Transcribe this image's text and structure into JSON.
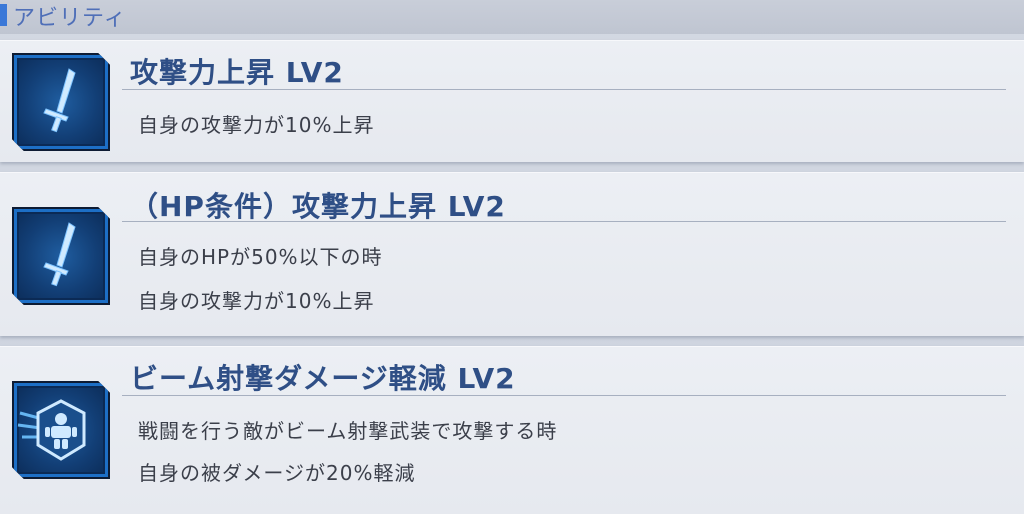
{
  "section": {
    "label": "アビリティ"
  },
  "abilities": [
    {
      "title": "攻撃力上昇 LV2",
      "icon": "sword-icon",
      "lines": [
        "自身の攻撃力が10%上昇"
      ]
    },
    {
      "title": "（HP条件）攻撃力上昇 LV2",
      "icon": "sword-icon",
      "lines": [
        "自身のHPが50%以下の時",
        "自身の攻撃力が10%上昇"
      ]
    },
    {
      "title": "ビーム射撃ダメージ軽減 LV2",
      "icon": "beam-shield-icon",
      "lines": [
        "戦闘を行う敵がビーム射撃武装で攻撃する時",
        "自身の被ダメージが20%軽減"
      ]
    }
  ],
  "colors": {
    "accent": "#3a78d8",
    "title": "#2f4f86",
    "icon_bg": "#123e75"
  }
}
